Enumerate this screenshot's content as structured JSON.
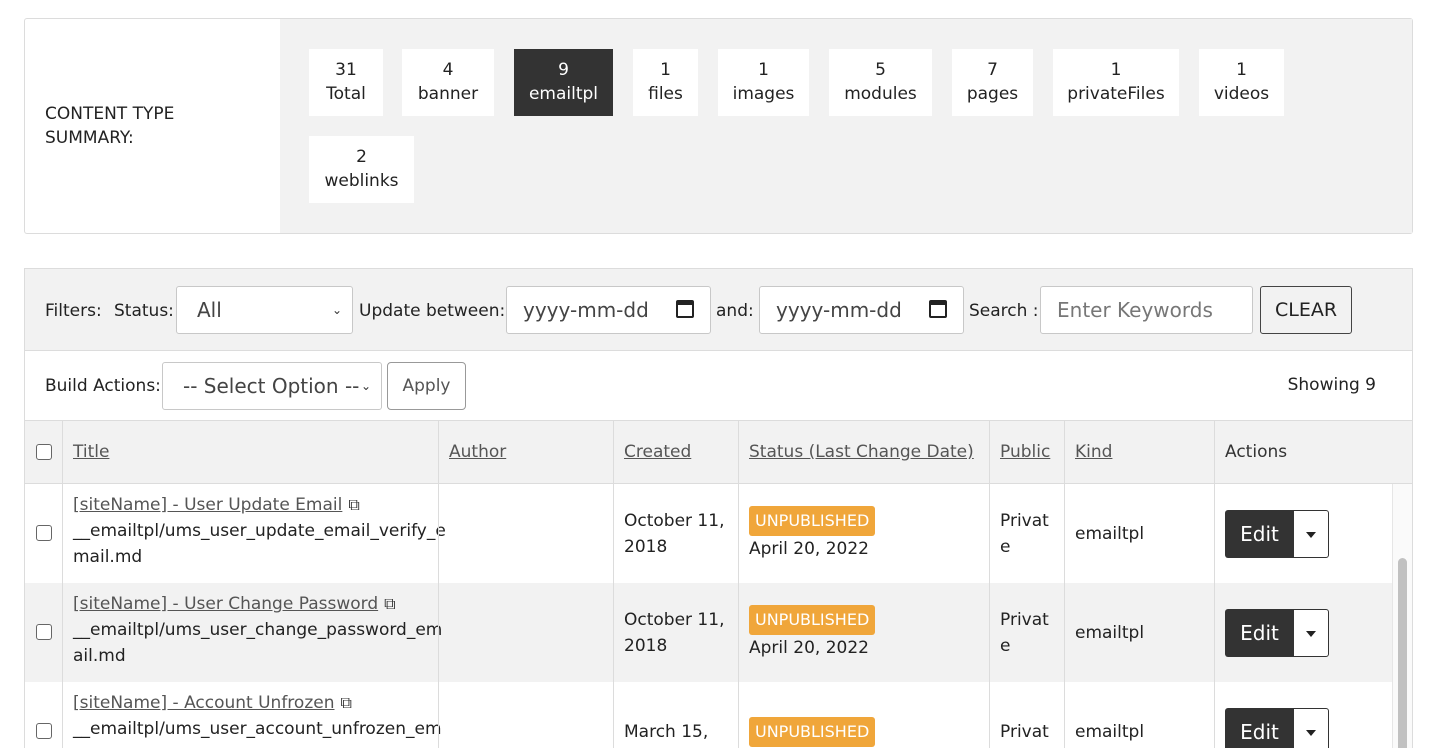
{
  "summary": {
    "label": "CONTENT TYPE SUMMARY:",
    "chips": [
      {
        "count": "31",
        "label": "Total",
        "active": false
      },
      {
        "count": "4",
        "label": "banner",
        "active": false
      },
      {
        "count": "9",
        "label": "emailtpl",
        "active": true
      },
      {
        "count": "1",
        "label": "files",
        "active": false
      },
      {
        "count": "1",
        "label": "images",
        "active": false
      },
      {
        "count": "5",
        "label": "modules",
        "active": false
      },
      {
        "count": "7",
        "label": "pages",
        "active": false
      },
      {
        "count": "1",
        "label": "privateFiles",
        "active": false
      },
      {
        "count": "1",
        "label": "videos",
        "active": false
      },
      {
        "count": "2",
        "label": "weblinks",
        "active": false
      }
    ]
  },
  "filters": {
    "filters_label": "Filters:",
    "status_label": "Status:",
    "status_value": "All",
    "update_between_label": "Update between:",
    "date_from_placeholder": "yyyy-mm-dd",
    "and_label": "and:",
    "date_to_placeholder": "yyyy-mm-dd",
    "search_label": "Search :",
    "search_placeholder": "Enter Keywords",
    "clear_label": "CLEAR"
  },
  "build_actions": {
    "label": "Build Actions:",
    "select_value": "-- Select Option --",
    "apply_label": "Apply",
    "showing": "Showing 9"
  },
  "table": {
    "headers": {
      "title": "Title",
      "author": "Author",
      "created": "Created",
      "status": "Status (Last Change Date)",
      "public": "Public",
      "kind": "Kind",
      "actions": "Actions"
    },
    "rows": [
      {
        "title": "[siteName] - User Update Email",
        "path_line1": "__emailtpl/ums_user_update_email_verify_e",
        "path_line2": "mail.md",
        "author": "",
        "created_line1": "October 11,",
        "created_line2": "2018",
        "status": "UNPUBLISHED",
        "status_date": "April 20, 2022",
        "public_line1": "Privat",
        "public_line2": "e",
        "kind": "emailtpl",
        "edit_label": "Edit"
      },
      {
        "title": "[siteName] - User Change Password",
        "path_line1": "__emailtpl/ums_user_change_password_em",
        "path_line2": "ail.md",
        "author": "",
        "created_line1": "October 11,",
        "created_line2": "2018",
        "status": "UNPUBLISHED",
        "status_date": "April 20, 2022",
        "public_line1": "Privat",
        "public_line2": "e",
        "kind": "emailtpl",
        "edit_label": "Edit"
      },
      {
        "title": "[siteName] - Account Unfrozen",
        "path_line1": "__emailtpl/ums_user_account_unfrozen_em",
        "path_line2": "",
        "author": "",
        "created_line1": "March 15,",
        "created_line2": "",
        "status": "UNPUBLISHED",
        "status_date": "",
        "public_line1": "Privat",
        "public_line2": "",
        "kind": "emailtpl",
        "edit_label": "Edit"
      }
    ]
  }
}
